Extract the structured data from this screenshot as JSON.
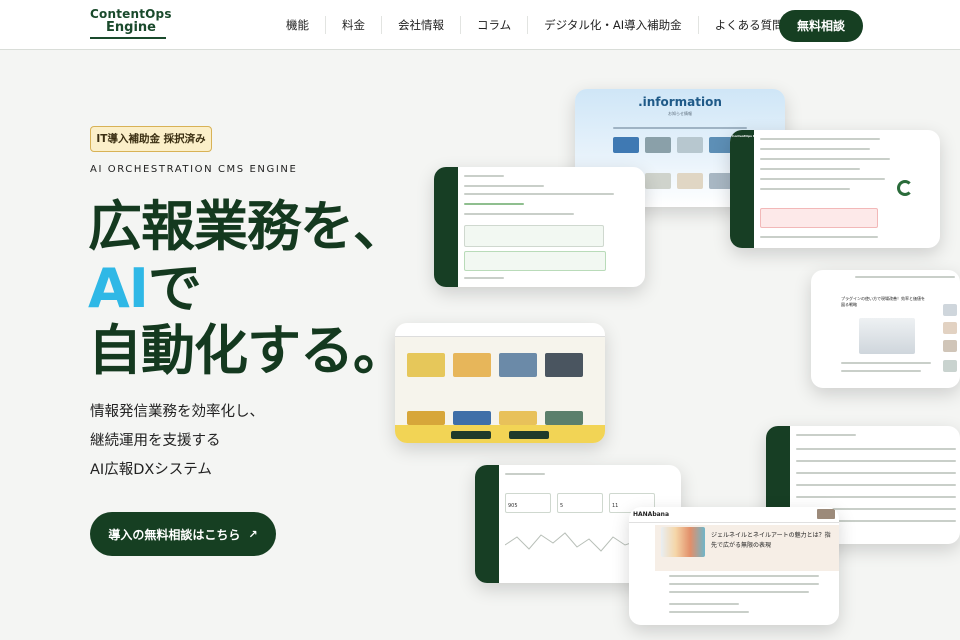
{
  "header": {
    "logo_line1": "ContentOps",
    "logo_line2": "Engine",
    "nav": [
      {
        "label": "機能"
      },
      {
        "label": "料金"
      },
      {
        "label": "会社情報"
      },
      {
        "label": "コラム"
      },
      {
        "label": "デジタル化・AI導入補助金"
      },
      {
        "label": "よくある質問"
      }
    ],
    "cta_label": "無料相談"
  },
  "hero": {
    "badge": "IT導入補助金 採択済み",
    "eyebrow": "AI ORCHESTRATION CMS ENGINE",
    "headline_line1": "広報業務を、",
    "headline_ai": "AI",
    "headline_line2_rest": "で",
    "headline_line3": "自動化する。",
    "sub_line1": "情報発信業務を効率化し、",
    "sub_line2": "継続運用を支援する",
    "sub_line3": "AI広報DXシステム",
    "cta_label": "導入の無料相談はこちら",
    "cta_arrow": "↗"
  },
  "screens": {
    "info_title": ".information",
    "info_subtitle": "お知らせ情報",
    "mini_logo": "ContentOps Engine",
    "blog_brand": "HANAbana",
    "article_title_line1": "ジェルネイルとネイルアートの魅力とは？指",
    "article_title_line2": "先で広がる無限の表現",
    "right_article_line1": "プラグインの使い方で現場改善！効率と価値を",
    "right_article_line2": "図る戦略",
    "stat_1": "905",
    "stat_2": "5",
    "stat_3": "11"
  },
  "colors": {
    "brand_green": "#163f22",
    "accent_blue": "#2fb8e6",
    "badge_bg": "#fbefc9",
    "badge_border": "#d8b256"
  }
}
